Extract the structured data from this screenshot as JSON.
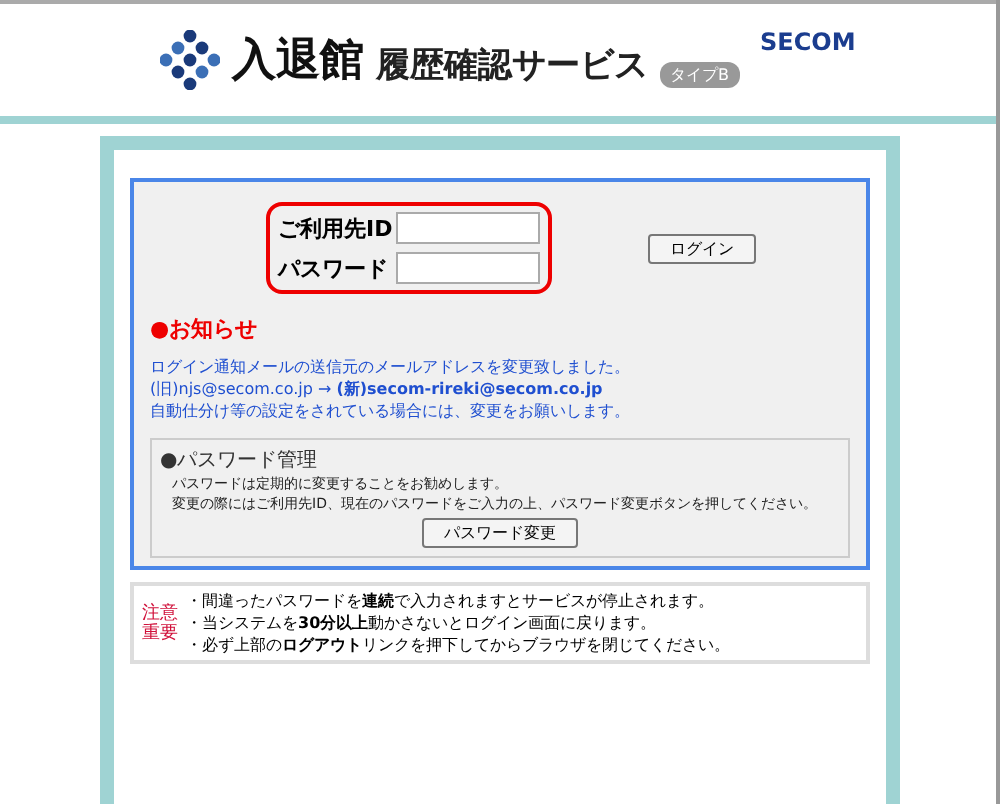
{
  "header": {
    "title": "入退館",
    "subtitle": "履歴確認サービス",
    "badge": "タイプB",
    "brand": "SECOM"
  },
  "login": {
    "fields": [
      {
        "label": "ご利用先ID"
      },
      {
        "label": "パスワード"
      }
    ],
    "button": "ログイン"
  },
  "news": {
    "heading": "●お知らせ",
    "lines": [
      "ログイン通知メールの送信元のメールアドレスを変更致しました。",
      "(旧)njs@secom.co.jp → **(新)secom-rireki@secom.co.jp**",
      "自動仕分け等の設定をされている場合には、変更をお願いします。"
    ]
  },
  "password_box": {
    "heading": "●パスワード管理",
    "lines": [
      "パスワードは定期的に変更することをお勧めします。",
      "変更の際にはご利用先ID、現在のパスワードをご入力の上、パスワード変更ボタンを押してください。"
    ],
    "button": "パスワード変更"
  },
  "notice": {
    "labels": [
      "注意",
      "重要"
    ],
    "lines": [
      "・間違ったパスワードを**連続**で入力されますとサービスが停止されます。",
      "・当システムを**30分以上**動かさないとログイン画面に戻ります。",
      "・必ず上部の**ログアウト**リンクを押下してからブラウザを閉じてください。"
    ]
  }
}
